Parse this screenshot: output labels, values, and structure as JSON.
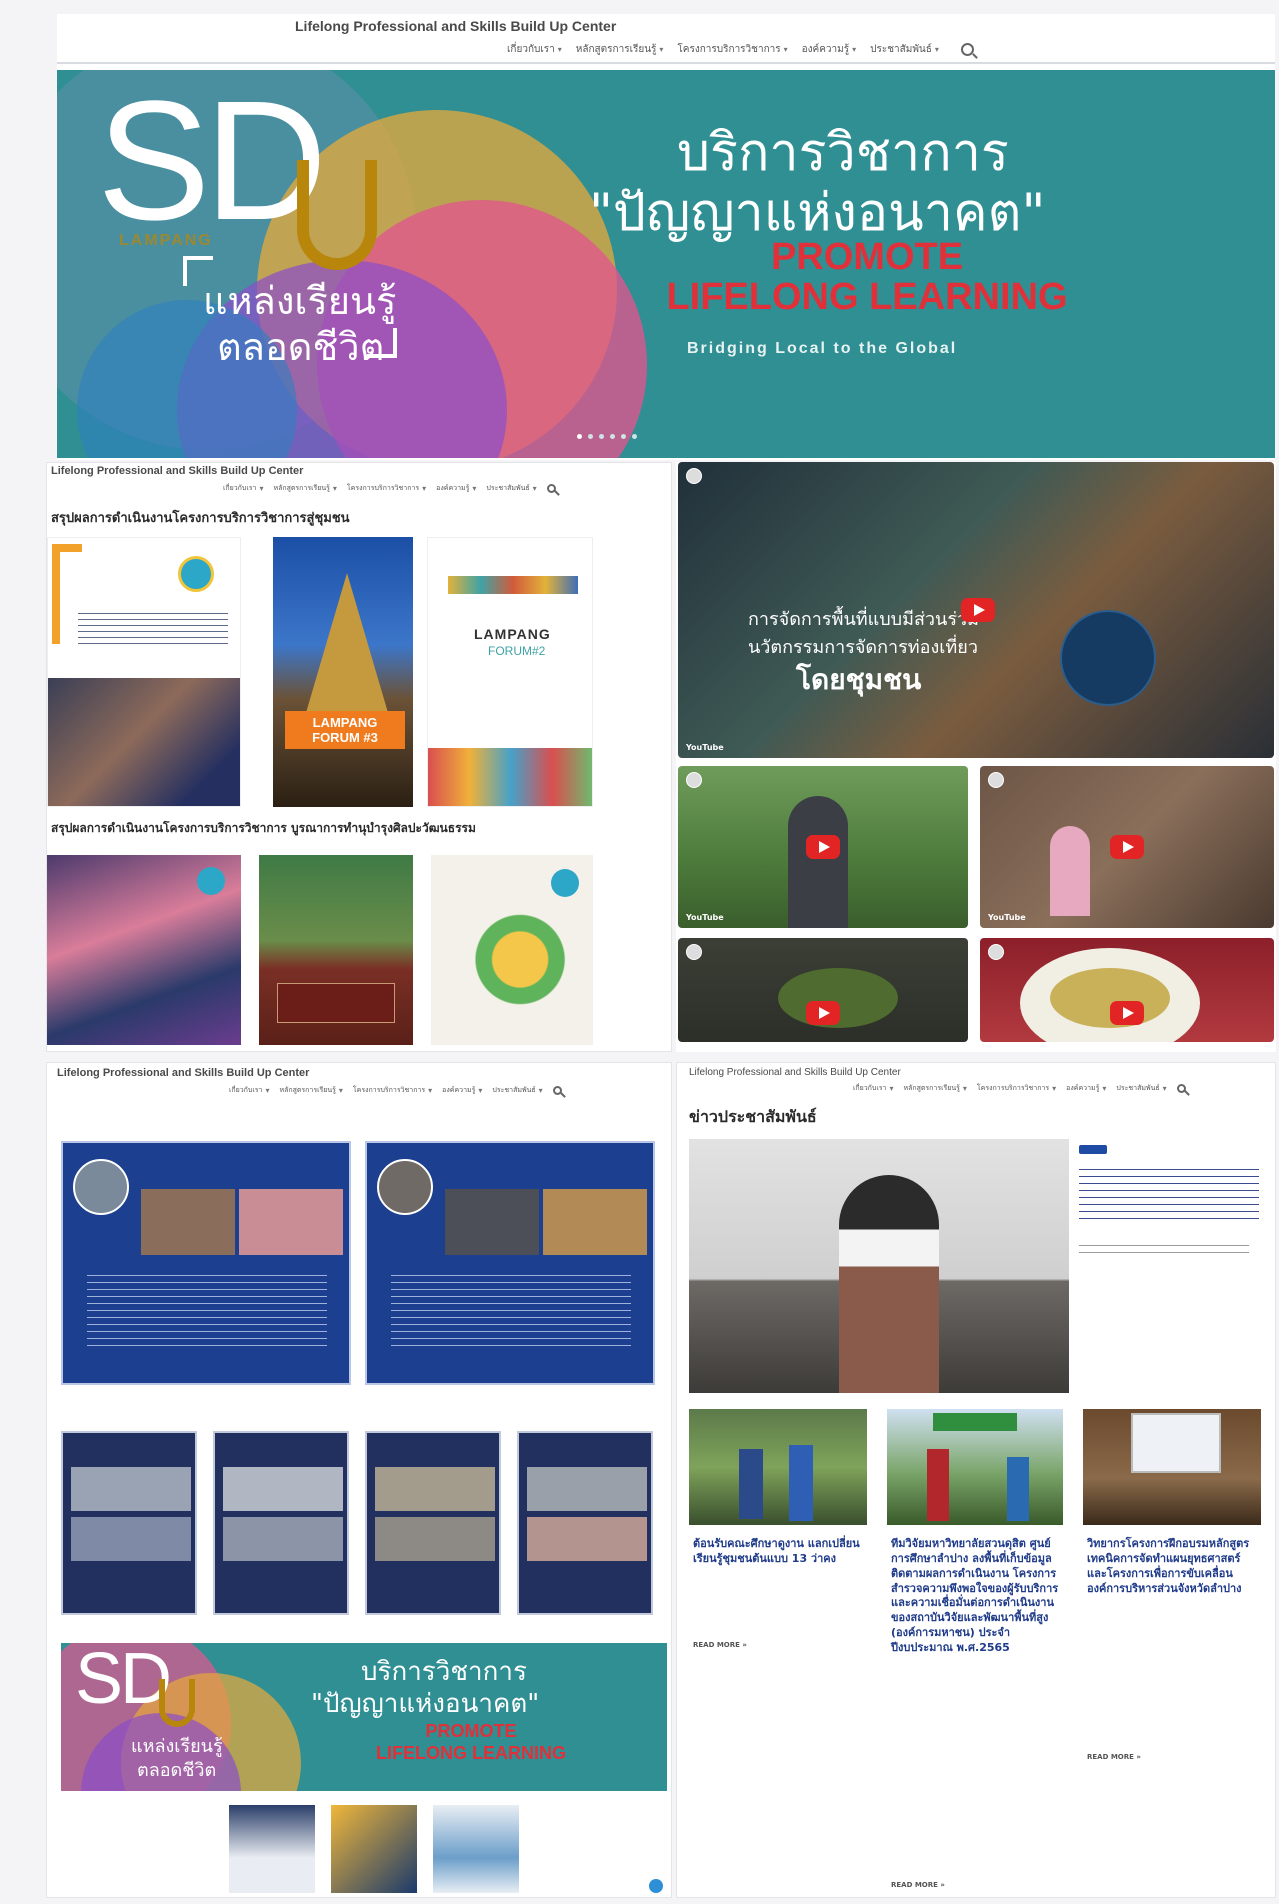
{
  "site": {
    "title": "Lifelong Professional and Skills Build Up Center",
    "menu": [
      "เกี่ยวกับเรา",
      "หลักสูตรการเรียนรู้",
      "โครงการบริการวิชาการ",
      "องค์ความรู้",
      "ประชาสัมพันธ์"
    ]
  },
  "hero": {
    "logo": "SD",
    "logo_sub": "LAMPANG",
    "tagline_line1": "แหล่งเรียนรู้",
    "tagline_line2": "ตลอดชีวิต",
    "heading_line1": "บริการวิชาการ",
    "heading_line2": "\"ปัญญาแห่งอนาคต\"",
    "promo_line1": "PROMOTE",
    "promo_line2": "LIFELONG LEARNING",
    "bridge": "Bridging Local to the Global"
  },
  "panel2": {
    "section1_title": "สรุปผลการดำเนินงานโครงการบริการวิชาการสู่ชุมชน",
    "section2_title": "สรุปผลการดำเนินงานโครงการบริการวิชาการ บูรณาการทำนุบำรุงศิลปะวัฒนธรรม",
    "forum3_label": "LAMPANG FORUM #3",
    "forum2_title": "LAMPANG",
    "forum2_sub": "FORUM#2"
  },
  "videos": {
    "main_caption1": "การจัดการพื้นที่แบบมีส่วนร่วม",
    "main_caption2": "นวัตกรรมการจัดการท่องเที่ยว",
    "main_caption3": "โดยชุมชน",
    "youtube": "YouTube"
  },
  "news": {
    "section_title": "ข่าวประชาสัมพันธ์",
    "cards": [
      {
        "title": "ต้อนรับคณะศึกษาดูงาน แลกเปลี่ยนเรียนรู้ชุมชนต้นแบบ 13 ว่าคง",
        "readmore": "READ MORE »"
      },
      {
        "title": "ทีมวิจัยมหาวิทยาลัยสวนดุสิต ศูนย์การศึกษาลำปาง ลงพื้นที่เก็บข้อมูล ติดตามผลการดำเนินงาน โครงการสำรวจความพึงพอใจของผู้รับบริการและความเชื่อมั่นต่อการดำเนินงานของสถาบันวิจัยและพัฒนาพื้นที่สูง (องค์การมหาชน) ประจำปีงบประมาณ พ.ศ.2565",
        "readmore": "READ MORE »"
      },
      {
        "title": "วิทยากรโครงการฝึกอบรมหลักสูตรเทคนิคการจัดทำแผนยุทธศาสตร์และโครงการเพื่อการขับเคลื่อนองค์การบริหารส่วนจังหวัดลำปาง",
        "readmore": "READ MORE »"
      }
    ]
  },
  "banner2": {
    "logo": "SD",
    "tagline_line1": "แหล่งเรียนรู้",
    "tagline_line2": "ตลอดชีวิต",
    "heading_line1": "บริการวิชาการ",
    "heading_line2": "\"ปัญญาแห่งอนาคต\"",
    "promo_line1": "PROMOTE",
    "promo_line2": "LIFELONG LEARNING"
  },
  "colors": {
    "hero_teal": "#2f8f93",
    "promo_red": "#e0313a",
    "accent_gold": "#b8860b",
    "news_blue": "#1f3b8a",
    "poster_blue": "#1c3f8f"
  }
}
